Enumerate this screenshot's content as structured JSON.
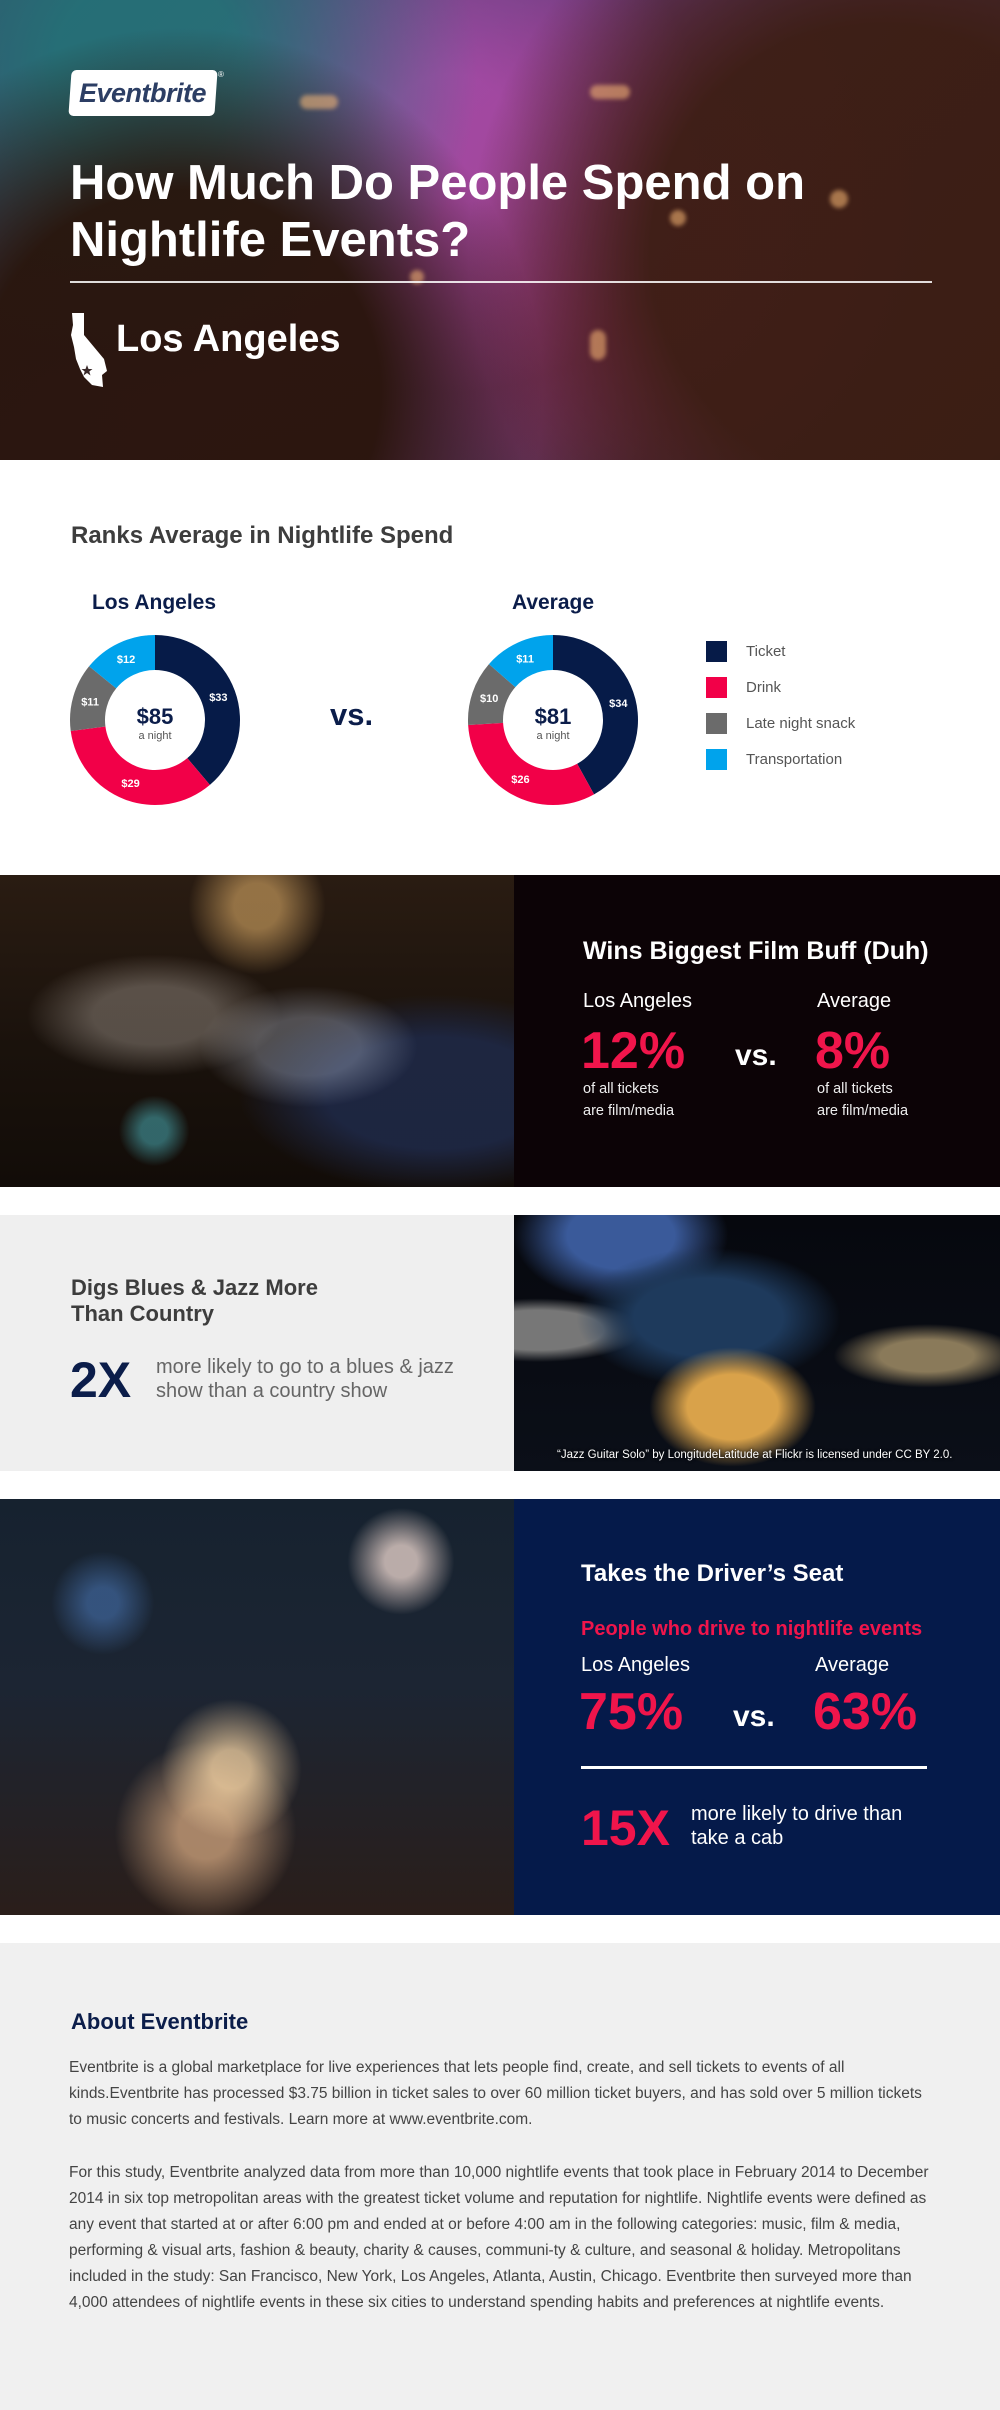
{
  "hero": {
    "logo_text": "Eventbrite",
    "logo_mark": "®",
    "title": "How Much Do People Spend on Nightlife Events?",
    "city": "Los Angeles",
    "city_icon": "california-state-icon"
  },
  "spend": {
    "title": "Ranks Average in Nightlife Spend",
    "vs_label": "vs.",
    "chart_data": {
      "type": "pie",
      "title": "Ranks Average in Nightlife Spend",
      "categories": [
        "Ticket",
        "Drink",
        "Late night snack",
        "Transportation"
      ],
      "colors": [
        "#061b48",
        "#f20048",
        "#6b6b6b",
        "#00a3ec"
      ],
      "series": [
        {
          "name": "Los Angeles",
          "values": [
            33,
            29,
            11,
            12
          ],
          "value_labels": [
            "$33",
            "$29",
            "$11",
            "$12"
          ],
          "total_label": "$85",
          "total_sub": "a night"
        },
        {
          "name": "Average",
          "values": [
            34,
            26,
            10,
            11
          ],
          "value_labels": [
            "$34",
            "$26",
            "$10",
            "$11"
          ],
          "total_label": "$81",
          "total_sub": "a night"
        }
      ],
      "legend_position": "right"
    }
  },
  "film": {
    "title": "Wins Biggest Film Buff (Duh)",
    "left_label": "Los Angeles",
    "left_value": "12%",
    "left_sub_1": "of all tickets",
    "left_sub_2": "are film/media",
    "vs_label": "vs.",
    "right_label": "Average",
    "right_value": "8%",
    "right_sub_1": "of all tickets",
    "right_sub_2": "are film/media"
  },
  "blues": {
    "title": "Digs Blues & Jazz More Than Country",
    "big": "2X",
    "text": "more likely to go to a blues & jazz show than a country show",
    "photo_credit": "“Jazz Guitar Solo” by LongitudeLatitude at Flickr is licensed under CC BY 2.0."
  },
  "drive": {
    "title": "Takes the Driver’s Seat",
    "subtitle": "People who drive to nightlife events",
    "left_label": "Los Angeles",
    "left_value": "75%",
    "vs_label": "vs.",
    "right_label": "Average",
    "right_value": "63%",
    "big": "15X",
    "text": "more likely to drive than take a cab"
  },
  "about": {
    "title": "About Eventbrite",
    "p1": "Eventbrite is a global marketplace for live experiences that lets people find, create, and sell tickets to events of all kinds.Eventbrite has processed $3.75 billion in ticket sales to over 60 million ticket buyers, and has sold over 5 million tickets to music concerts and festivals. Learn more at www.eventbrite.com.",
    "p2": "For this study, Eventbrite analyzed data from more than 10,000 nightlife events that took place in February 2014 to December 2014 in six top metropolitan areas with the greatest ticket volume and reputation for nightlife. Nightlife events were defined as any event that started at or after 6:00 pm and ended at or before 4:00 am in the following categories: music, film & media, performing & visual arts, fashion & beauty, charity & causes, communi-ty & culture, and seasonal & holiday. Metropolitans included in the study: San Francisco, New York, Los Angeles, Atlanta, Austin, Chicago. Eventbrite then surveyed more than 4,000 attendees of nightlife events in these six cities to understand spending habits and preferences at nightlife events."
  }
}
